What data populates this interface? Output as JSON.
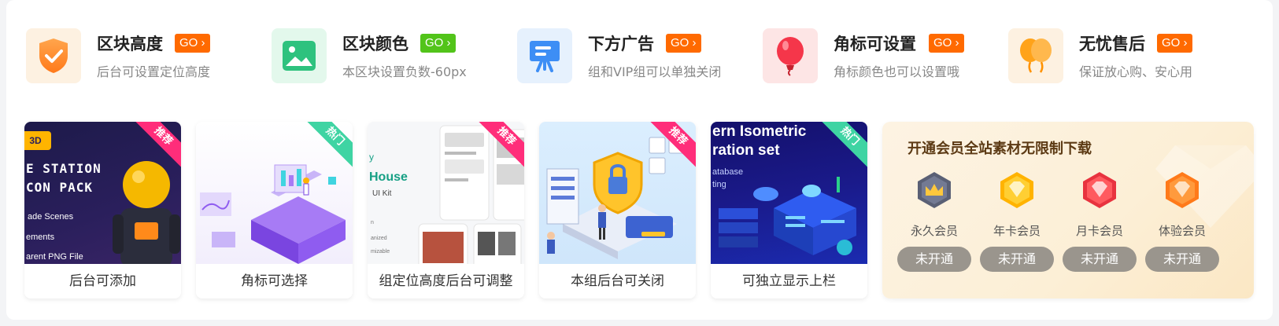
{
  "features": [
    {
      "title": "区块高度",
      "go": "GO",
      "desc": "后台可设置定位高度",
      "icon": "shield-check-icon",
      "go_color": "#ff6a00",
      "bg": "#fdf1e1"
    },
    {
      "title": "区块颜色",
      "go": "GO",
      "desc": "本区块设置负数-60px",
      "icon": "image-icon",
      "go_color": "#52c41a",
      "bg": "#e3f8ec"
    },
    {
      "title": "下方广告",
      "go": "GO",
      "desc": "组和VIP组可以单独关闭",
      "icon": "easel-icon",
      "go_color": "#ff6a00",
      "bg": "#e6f1fd"
    },
    {
      "title": "角标可设置",
      "go": "GO",
      "desc": "角标颜色也可以设置哦",
      "icon": "balloon-icon",
      "go_color": "#ff6a00",
      "bg": "#fde5e5"
    },
    {
      "title": "无忧售后",
      "go": "GO",
      "desc": "保证放心购、安心用",
      "icon": "balloons-icon",
      "go_color": "#ff6a00",
      "bg": "#fdf1e1"
    }
  ],
  "cards": [
    {
      "caption": "后台可添加",
      "ribbon": "推荐",
      "ribbon_color": "#ff2d7a",
      "thumb": {
        "tag": "3D",
        "line1": "E STATION",
        "line2": "CON PACK",
        "items": [
          "ade Scenes",
          "ements",
          "arent PNG File"
        ]
      }
    },
    {
      "caption": "角标可选择",
      "ribbon": "热门",
      "ribbon_color": "#3fd4a3"
    },
    {
      "caption": "组定位高度后台可调整",
      "ribbon": "推荐",
      "ribbon_color": "#ff2d7a",
      "thumb": {
        "line1": "y",
        "line2": "House",
        "line3": "UI Kit"
      }
    },
    {
      "caption": "本组后台可关闭",
      "ribbon": "推荐",
      "ribbon_color": "#ff2d7a"
    },
    {
      "caption": "可独立显示上栏",
      "ribbon": "热门",
      "ribbon_color": "#3fd4a3",
      "thumb": {
        "line1": "ern Isometric",
        "line2": "ration set",
        "line3": "atabase",
        "line4": "ting"
      }
    }
  ],
  "vip": {
    "title": "开通会员全站素材无限制下载",
    "tiers": [
      {
        "name": "永久会员",
        "button": "未开通",
        "icon": "crown-icon"
      },
      {
        "name": "年卡会员",
        "button": "未开通",
        "icon": "diamond-icon"
      },
      {
        "name": "月卡会员",
        "button": "未开通",
        "icon": "diamond-icon"
      },
      {
        "name": "体验会员",
        "button": "未开通",
        "icon": "diamond-icon"
      }
    ]
  }
}
